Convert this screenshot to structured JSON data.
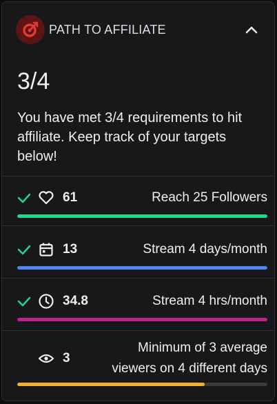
{
  "header": {
    "title": "PATH TO AFFILIATE",
    "logo_color": "#e53935"
  },
  "progress_count": "3/4",
  "description": "You have met 3/4 requirements to hit affiliate. Keep track of your targets below!",
  "requirements": [
    {
      "icon": "heart-icon",
      "value": "61",
      "label": "Reach 25 Followers",
      "met": true,
      "progress": 1.0,
      "color": "#1ed88b"
    },
    {
      "icon": "calendar-icon",
      "value": "13",
      "label": "Stream 4 days/month",
      "met": true,
      "progress": 1.0,
      "color": "#4f86f7"
    },
    {
      "icon": "clock-icon",
      "value": "34.8",
      "label": "Stream 4 hrs/month",
      "met": true,
      "progress": 1.0,
      "color": "#c21f8f"
    },
    {
      "icon": "eye-icon",
      "value": "3",
      "label": "Minimum of 3 average viewers on 4 different days",
      "met": false,
      "progress": 0.75,
      "color": "#f5b02a"
    }
  ]
}
